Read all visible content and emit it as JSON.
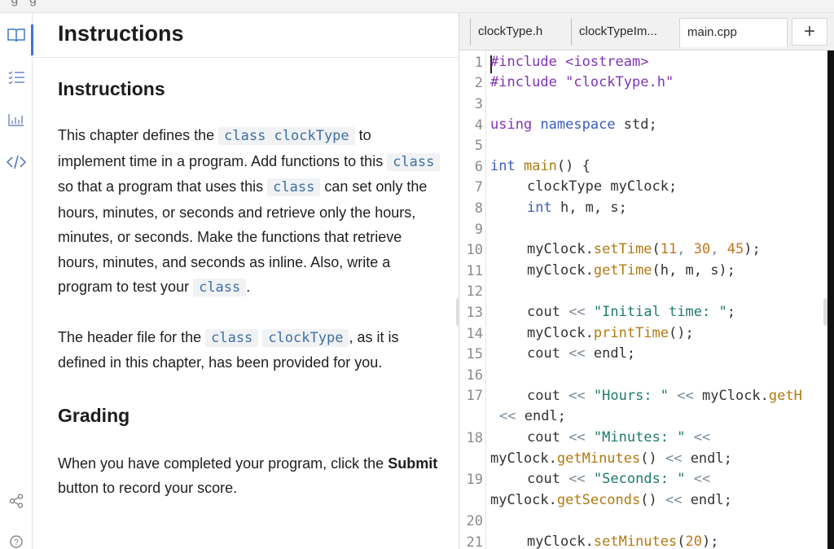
{
  "instructions": {
    "header_title": "Instructions",
    "heading": "Instructions",
    "p1": {
      "t1": "This chapter defines the ",
      "c1": "class clockType",
      "t2": " to implement time in a program. Add functions to this ",
      "c2": "class",
      "t3": " so that a program that uses this ",
      "c3": "class",
      "t4": " can set only the hours, minutes, or seconds and retrieve only the hours, minutes, or seconds. Make the functions that retrieve hours, minutes, and seconds as inline. Also, write a program to test your ",
      "c4": "class",
      "t5": "."
    },
    "p2": {
      "t1": "The header file for the ",
      "c1": "class",
      "c2": "clockType",
      "t2": ", as it is defined in this chapter, has been provided for you."
    },
    "grading_heading": "Grading",
    "p3": {
      "t1": "When you have completed your program, click the ",
      "b1": "Submit",
      "t2": " button to record your score."
    }
  },
  "rail": {
    "icons": [
      "book-icon",
      "list-icon",
      "chart-icon",
      "code-icon",
      "share-icon",
      "help-icon"
    ]
  },
  "tabs": [
    {
      "label": "clockType.h"
    },
    {
      "label": "clockTypeIm..."
    },
    {
      "label": "main.cpp"
    }
  ],
  "add_tab_label": "+",
  "line_numbers": [
    "1",
    "2",
    "3",
    "4",
    "5",
    "6",
    "7",
    "8",
    "9",
    "10",
    "11",
    "12",
    "13",
    "14",
    "15",
    "16",
    "17",
    "18",
    "19",
    "20",
    "21"
  ],
  "code": {
    "l1": [
      "#include",
      " <iostream>"
    ],
    "l2": [
      "#include",
      " \"clockType.h\""
    ],
    "l4": [
      "using",
      " ",
      "namespace",
      " std;"
    ],
    "l6": [
      "int",
      " ",
      "main",
      "() {"
    ],
    "l7": "clockType myClock;",
    "l8": [
      "int",
      " h, m, s;"
    ],
    "l10": [
      "myClock.",
      "setTime",
      "(",
      "11",
      ", ",
      "30",
      ", ",
      "45",
      ");"
    ],
    "l11": [
      "myClock.",
      "getTime",
      "(h, m, s);"
    ],
    "l13": [
      "cout ",
      "<<",
      " ",
      "\"Initial time: \"",
      ";"
    ],
    "l14": [
      "myClock.",
      "printTime",
      "();"
    ],
    "l15": [
      "cout ",
      "<<",
      " endl;"
    ],
    "l17a": [
      "cout ",
      "<<",
      " ",
      "\"Hours: \"",
      " ",
      "<<",
      " myClock.",
      "getH"
    ],
    "l17b": [
      "<<",
      " endl;"
    ],
    "l18a": [
      "cout ",
      "<<",
      " ",
      "\"Minutes: \"",
      " ",
      "<<"
    ],
    "l18b": [
      "myClock.",
      "getMinutes",
      "() ",
      "<<",
      " endl;"
    ],
    "l19a": [
      "cout ",
      "<<",
      " ",
      "\"Seconds: \"",
      " ",
      "<<"
    ],
    "l19b": [
      "myClock.",
      "getSeconds",
      "() ",
      "<<",
      " endl;"
    ],
    "l21": [
      "myClock.",
      "setMinutes",
      "(",
      "20",
      ");"
    ]
  },
  "colors": {
    "accent": "#3d77c9",
    "code_inline": "#3f6fa5",
    "keyword": "#8034b8",
    "type": "#3b5bbf",
    "string": "#1d7a6b",
    "func": "#b07a10",
    "number": "#c0761a"
  }
}
